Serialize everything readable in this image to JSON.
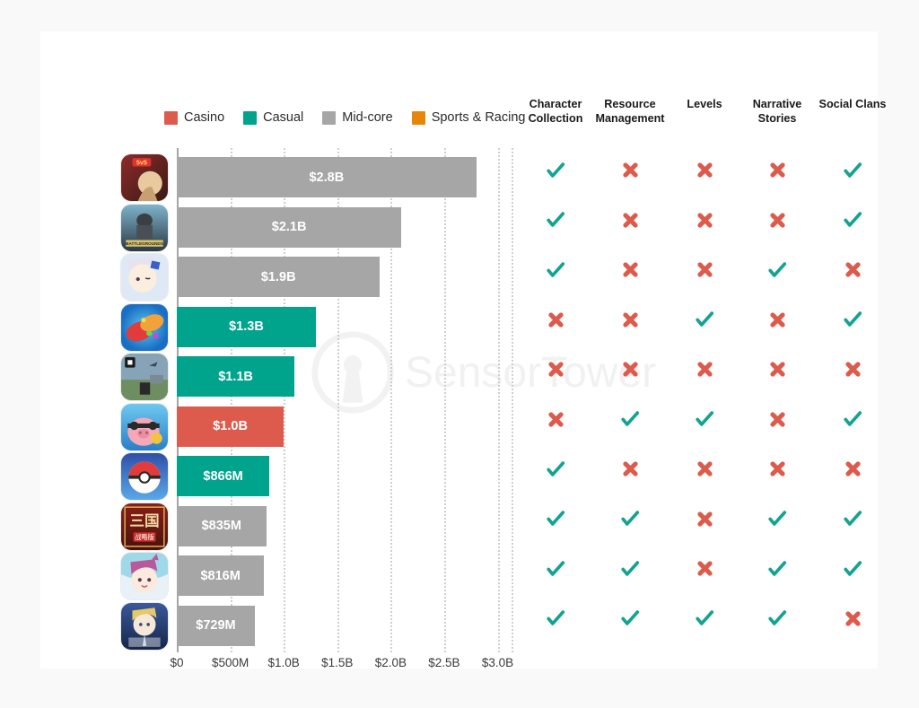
{
  "colors": {
    "casino": "#dd5b4c",
    "casual": "#00a38c",
    "midcore": "#a6a6a6",
    "sports": "#e8860a",
    "check": "#13a391",
    "cross": "#dd5b4c",
    "grid": "#cfcfcf",
    "divider": "#1a1a1a",
    "page_background": "#f9f9fa",
    "card_background": "#ffffff"
  },
  "watermark": {
    "text": "SensorTower",
    "icon": "sensor-tower-logo"
  },
  "legend": {
    "items": [
      {
        "label": "Casino",
        "color_key": "casino"
      },
      {
        "label": "Casual",
        "color_key": "casual"
      },
      {
        "label": "Mid-core",
        "color_key": "midcore"
      },
      {
        "label": "Sports & Racing",
        "color_key": "sports"
      }
    ]
  },
  "chart_data": {
    "type": "bar",
    "orientation": "horizontal",
    "title": "",
    "xlabel": "",
    "ylabel": "",
    "xlim": [
      0,
      3130000000
    ],
    "grid": true,
    "legend_position": "top-left",
    "xticks": [
      {
        "label": "$0",
        "value": 0
      },
      {
        "label": "$500M",
        "value": 500000000
      },
      {
        "label": "$1.0B",
        "value": 1000000000
      },
      {
        "label": "$1.5B",
        "value": 1500000000
      },
      {
        "label": "$2.0B",
        "value": 2000000000
      },
      {
        "label": "$2.5B",
        "value": 2500000000
      },
      {
        "label": "$3.0B",
        "value": 3000000000
      }
    ],
    "categories": [
      "honor-of-kings",
      "pubg-mobile",
      "genshin-impact",
      "candy-crush-saga",
      "roblox",
      "coin-master",
      "pokemon-go",
      "three-kingdoms-tactics",
      "uma-musume",
      "fate-grand-order"
    ],
    "values": [
      2800000000,
      2100000000,
      1900000000,
      1300000000,
      1100000000,
      1000000000,
      866000000,
      835000000,
      816000000,
      729000000
    ],
    "value_labels": [
      "$2.8B",
      "$2.1B",
      "$1.9B",
      "$1.3B",
      "$1.1B",
      "$1.0B",
      "$866M",
      "$835M",
      "$816M",
      "$729M"
    ],
    "series_colors": [
      "midcore",
      "midcore",
      "midcore",
      "casual",
      "casual",
      "casino",
      "casual",
      "midcore",
      "midcore",
      "midcore"
    ]
  },
  "matrix": {
    "columns": [
      {
        "label": "Character\nCollection",
        "line1": "Character",
        "line2": "Collection"
      },
      {
        "label": "Resource\nManagement",
        "line1": "Resource",
        "line2": "Management"
      },
      {
        "label": "Levels",
        "line1": "Levels",
        "line2": ""
      },
      {
        "label": "Narrative\nStories",
        "line1": "Narrative",
        "line2": "Stories"
      },
      {
        "label": "Social Clans",
        "line1": "Social Clans",
        "line2": ""
      }
    ],
    "rows": [
      {
        "game": "honor-of-kings",
        "cells": [
          "check",
          "cross",
          "cross",
          "cross",
          "check"
        ]
      },
      {
        "game": "pubg-mobile",
        "cells": [
          "check",
          "cross",
          "cross",
          "cross",
          "check"
        ]
      },
      {
        "game": "genshin-impact",
        "cells": [
          "check",
          "cross",
          "cross",
          "check",
          "cross"
        ]
      },
      {
        "game": "candy-crush-saga",
        "cells": [
          "cross",
          "cross",
          "check",
          "cross",
          "check"
        ]
      },
      {
        "game": "roblox",
        "cells": [
          "cross",
          "cross",
          "cross",
          "cross",
          "cross"
        ]
      },
      {
        "game": "coin-master",
        "cells": [
          "cross",
          "check",
          "check",
          "cross",
          "check"
        ]
      },
      {
        "game": "pokemon-go",
        "cells": [
          "check",
          "cross",
          "cross",
          "cross",
          "cross"
        ]
      },
      {
        "game": "three-kingdoms-tactics",
        "cells": [
          "check",
          "check",
          "cross",
          "check",
          "check"
        ]
      },
      {
        "game": "uma-musume",
        "cells": [
          "check",
          "check",
          "cross",
          "check",
          "check"
        ]
      },
      {
        "game": "fate-grand-order",
        "cells": [
          "check",
          "check",
          "check",
          "check",
          "cross"
        ]
      }
    ]
  }
}
